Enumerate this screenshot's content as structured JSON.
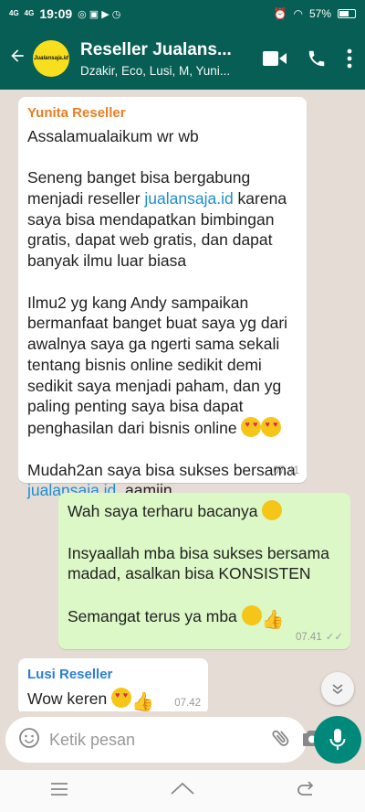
{
  "status": {
    "network": "4G",
    "time": "19:09",
    "battery": "57%"
  },
  "header": {
    "avatar_text": "Jualansaja.id",
    "title": "Reseller Jualans...",
    "subtitle": "Dzakir, Eco, Lusi, M, Yuni..."
  },
  "messages": {
    "m1": {
      "sender": "Yunita Reseller",
      "p1": "Assalamualaikum wr wb",
      "p2a": "Seneng banget bisa bergabung menjadi reseller ",
      "p2link": "jualansaja.id",
      "p2b": " karena saya bisa mendapatkan bimbingan gratis, dapat web gratis, dan dapat banyak ilmu luar biasa",
      "p3": "Ilmu2 yg kang Andy sampaikan bermanfaat banget buat saya yg dari awalnya saya ga ngerti sama sekali tentang bisnis online sedikit demi sedikit saya menjadi paham, dan yg paling penting saya bisa dapat penghasilan dari bisnis online ",
      "p4a": "Mudah2an saya bisa sukses bersama ",
      "p4link": "jualansaja.id",
      "p4b": "  aamiin",
      "time": "07.41"
    },
    "m2": {
      "p1": "Wah saya terharu bacanya ",
      "p2": "Insyaallah mba bisa sukses bersama madad, asalkan bisa KONSISTEN",
      "p3": "Semangat terus ya mba ",
      "time": "07.41"
    },
    "m3": {
      "sender": "Lusi Reseller",
      "text": "Wow keren ",
      "time": "07.42"
    }
  },
  "input": {
    "placeholder": "Ketik pesan"
  },
  "colors": {
    "header": "#075e54",
    "outgoing": "#dcf8c6",
    "mic": "#00897b"
  },
  "icons": [
    "back-arrow-icon",
    "video-call-icon",
    "phone-icon",
    "more-icon",
    "emoji-icon",
    "attach-icon",
    "camera-icon",
    "mic-icon",
    "scroll-down-icon"
  ]
}
